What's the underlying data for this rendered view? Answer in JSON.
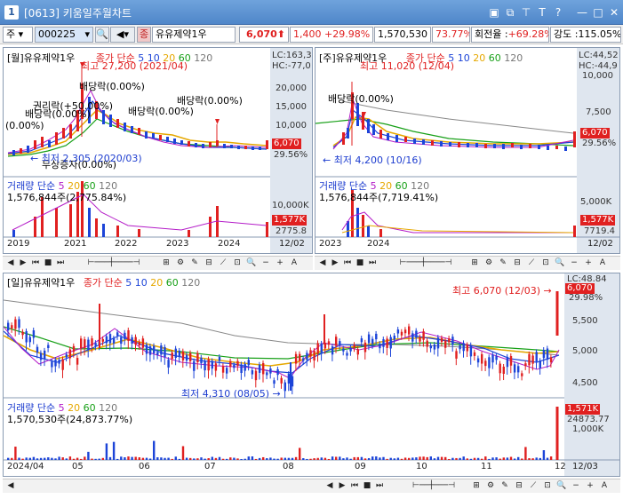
{
  "window": {
    "number": "1",
    "title": "[0613] 키움일주월차트"
  },
  "toolbar": {
    "market": "주",
    "code": "000225",
    "stock_name": "유유제약1우",
    "price": "6,070",
    "change": "1,400",
    "change_pct": "+29.98%",
    "volume": "1,570,530",
    "vol_pct": "73.77%",
    "turnover_label": "회전율 :",
    "turnover": "+69.28%",
    "strength_label": "강도 :",
    "strength": "115.05%"
  },
  "monthly": {
    "header": "[월]유유제약1우",
    "ma_label": "종가 단순",
    "ma": [
      "5",
      "10",
      "20",
      "60",
      "120"
    ],
    "lc": "LC:163,3",
    "hc": "HC:-77,0",
    "high_label": "최고 27,200 (2021/04)",
    "low_label": "최저 2,305 (2020/03)",
    "annotations": [
      "배당락(0.00%)",
      "배당락(0.00%)",
      "배당락(0.00%)",
      "권리락(+50.00%)",
      "배당락(0.00%)",
      "배당락(0.00%)",
      "(0.00%)",
      "무상증자(0.00%)"
    ],
    "scale": [
      "20,000",
      "15,000",
      "10,000",
      "5,000"
    ],
    "price_tag": "6,070",
    "pct_tag": "29.56%",
    "vol_header": "거래량",
    "vol_ma_label": "단순",
    "vol_value": "1,576,844주(2,775.84%)",
    "vol_scale": "10,000K",
    "vol_tag": "1,577K",
    "vol_tag2": "2775.8",
    "x": [
      "2019",
      "2021",
      "2022",
      "2023",
      "2024",
      "12/02"
    ]
  },
  "weekly": {
    "header": "[주]유유제약1우",
    "ma_label": "종가 단순",
    "ma": [
      "5",
      "10",
      "20",
      "60",
      "120"
    ],
    "lc": "LC:44,52",
    "hc": "HC:-44,9",
    "high_label": "최고 11,020 (12/04)",
    "low_label": "최저 4,200 (10/16)",
    "annotation": "배당락(0.00%)",
    "scale": [
      "10,000",
      "7,500",
      "5,000"
    ],
    "price_tag": "6,070",
    "pct_tag": "29.56%",
    "vol_header": "거래량",
    "vol_ma_label": "단순",
    "vol_value": "1,576,844주(7,719.41%)",
    "vol_scale": "5,000K",
    "vol_tag": "1,577K",
    "vol_tag2": "7719.4",
    "x": [
      "2023",
      "2024",
      "12/02"
    ]
  },
  "daily": {
    "header": "[일]유유제약1우",
    "ma_label": "종가 단순",
    "ma": [
      "5",
      "10",
      "20",
      "60",
      "120"
    ],
    "lc": "LC:48.84",
    "high_label": "최고 6,070 (12/03)",
    "low_label": "최저 4,310 (08/05)",
    "scale": [
      "6,000",
      "5,500",
      "5,000",
      "4,500"
    ],
    "price_tag": "6,070",
    "pct_tag": "29.98%",
    "vol_header": "거래량",
    "vol_ma_label": "단순",
    "vol_value": "1,570,530주(24,873.77%)",
    "vol_scale": "1,000K",
    "vol_tag": "1,571K",
    "vol_tag2": "24873.77",
    "x": [
      "2024/04",
      "05",
      "06",
      "07",
      "08",
      "09",
      "10",
      "11",
      "12",
      "12/03"
    ]
  },
  "colors": {
    "up": "#e02020",
    "down": "#1c44d8",
    "ma5": "#b41cc8",
    "ma10": "#1c44d8",
    "ma20": "#e6a800",
    "ma60": "#18a018",
    "ma120": "#888888"
  }
}
